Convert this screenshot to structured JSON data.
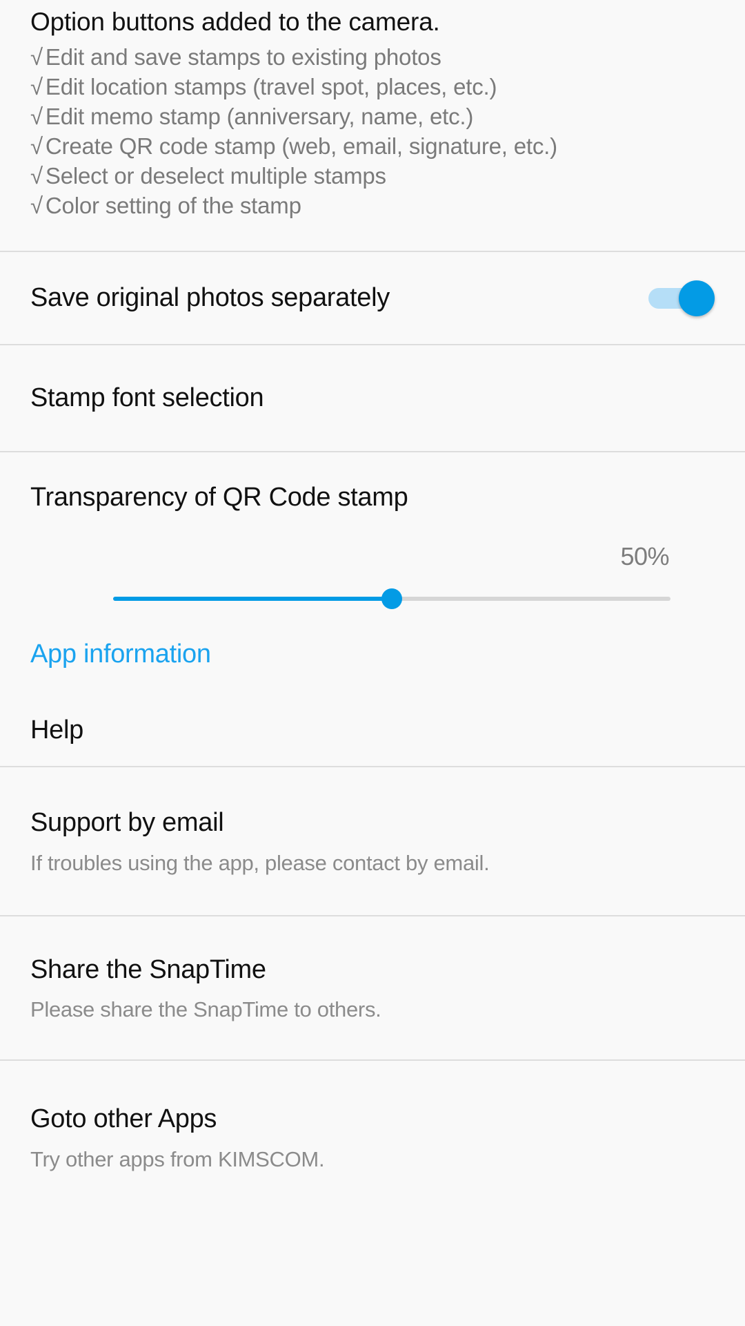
{
  "theme": {
    "background": "#f9f9f9",
    "divider": "#dddddd",
    "accent": "#039be5",
    "link": "#1aa3ef",
    "track_on": "#b5def7",
    "primary_text": "#111111",
    "secondary_text": "#8b8b8b"
  },
  "intro": {
    "title": "Option buttons added to the camera.",
    "check_glyph": "√",
    "items": [
      "Edit and save stamps to existing photos",
      "Edit location stamps (travel spot, places, etc.)",
      "Edit memo stamp (anniversary, name, etc.)",
      "Create QR code stamp (web, email, signature, etc.)",
      "Select or deselect multiple stamps",
      "Color setting of the stamp"
    ]
  },
  "settings": {
    "save_original": {
      "title": "Save original photos separately",
      "toggle_state": "on"
    },
    "stamp_font": {
      "title": "Stamp font selection"
    },
    "transparency": {
      "title": "Transparency of QR Code stamp",
      "value_label": "50%",
      "value_percent": 50,
      "min": 0,
      "max": 100
    },
    "app_information": {
      "title": "App information"
    },
    "help": {
      "title": "Help"
    },
    "support_email": {
      "title": "Support by email",
      "subtitle": "If troubles using the app, please contact by email."
    },
    "share": {
      "title": "Share the SnapTime",
      "subtitle": "Please share the SnapTime to others."
    },
    "other_apps": {
      "title": "Goto other Apps",
      "subtitle": "Try other apps from KIMSCOM."
    }
  }
}
